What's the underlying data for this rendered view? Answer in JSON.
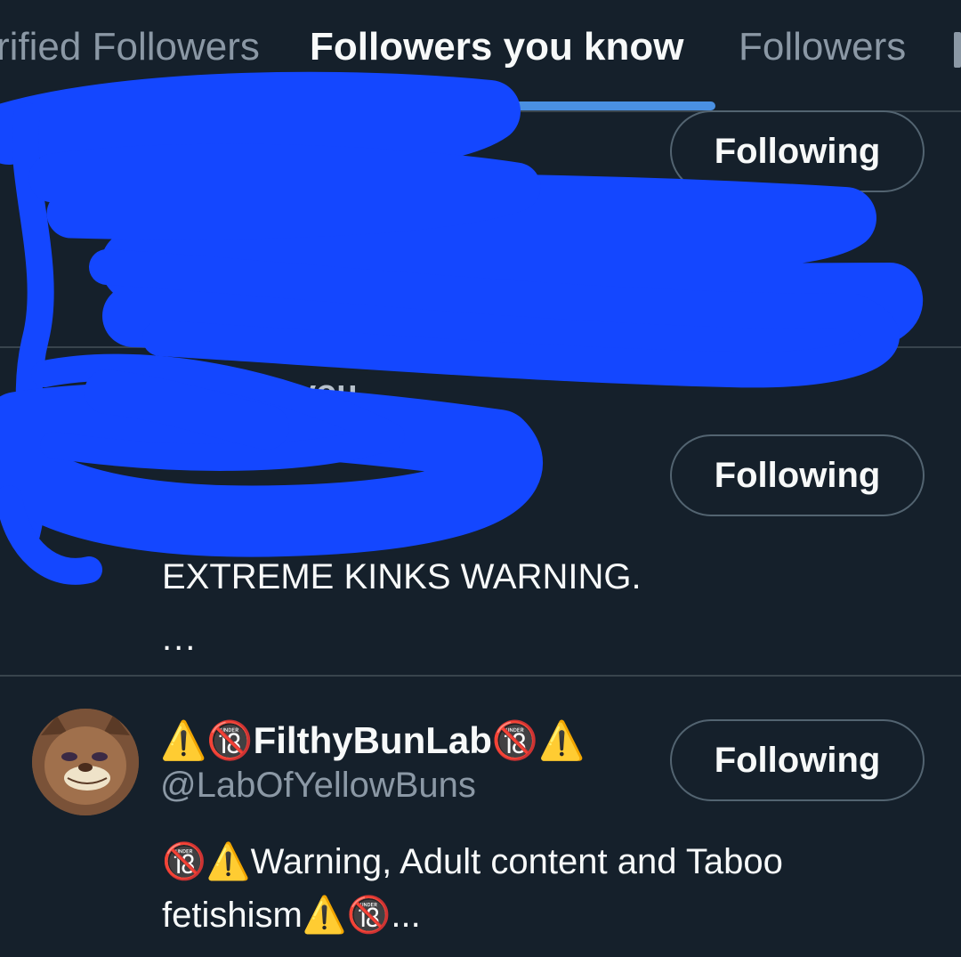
{
  "tabs": [
    {
      "label": "rified Followers"
    },
    {
      "label": "Followers you know"
    },
    {
      "label": "Followers"
    }
  ],
  "active_tab": "Followers you know",
  "accent_color": "#4a90e2",
  "redaction_color": "#1447ff",
  "rows": [
    {
      "button_label": "Following",
      "ellipsis": "..."
    },
    {
      "follows_you": "Follows you",
      "button_label": "Following",
      "bio": "EXTREME KINKS WARNING.",
      "ellipsis": "..."
    },
    {
      "display_name": "⚠️🔞FilthyBunLab🔞⚠️",
      "handle": "@LabOfYellowBuns",
      "button_label": "Following",
      "bio_line1": "🔞⚠️Warning, Adult content and Taboo",
      "bio_line2": "fetishism⚠️🔞..."
    }
  ]
}
